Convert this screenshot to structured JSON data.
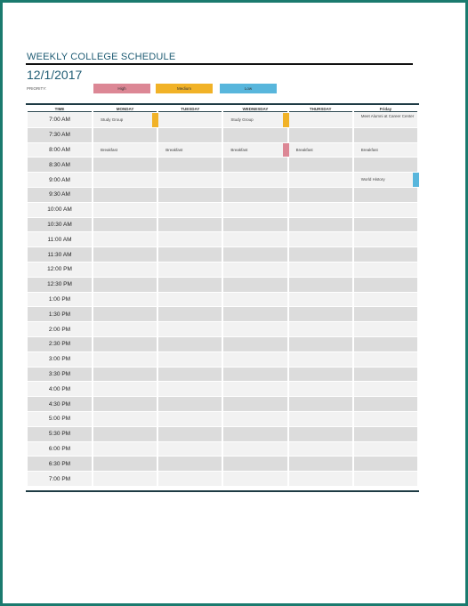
{
  "doc": {
    "title": "WEEKLY COLLEGE SCHEDULE",
    "date": "12/1/2017",
    "priority_label": "PRIORITY:",
    "priorities": {
      "high": "High",
      "medium": "Medium",
      "low": "Low"
    }
  },
  "colors": {
    "high": "#dc8795",
    "medium": "#f1b227",
    "low": "#58b6dc",
    "frame": "#1a7a6e"
  },
  "headers": [
    "TIME",
    "MONDAY",
    "TUESDAY",
    "WEDNESDAY",
    "THURSDAY",
    "Friday"
  ],
  "rows": [
    {
      "time": "7:00 AM",
      "cells": [
        {
          "text": "Study Group",
          "flag": "medium"
        },
        {
          "text": ""
        },
        {
          "text": "Study Group",
          "flag": "medium"
        },
        {
          "text": ""
        },
        {
          "text": "Meet Alumni at Career Center"
        }
      ]
    },
    {
      "time": "7:30 AM",
      "cells": [
        {
          "text": ""
        },
        {
          "text": ""
        },
        {
          "text": ""
        },
        {
          "text": ""
        },
        {
          "text": ""
        }
      ]
    },
    {
      "time": "8:00 AM",
      "cells": [
        {
          "text": "Breakfast"
        },
        {
          "text": "Breakfast"
        },
        {
          "text": "Breakfast",
          "flag": "high"
        },
        {
          "text": "Breakfast"
        },
        {
          "text": "Breakfast"
        }
      ]
    },
    {
      "time": "8:30 AM",
      "cells": [
        {
          "text": ""
        },
        {
          "text": ""
        },
        {
          "text": ""
        },
        {
          "text": ""
        },
        {
          "text": ""
        }
      ]
    },
    {
      "time": "9:00 AM",
      "cells": [
        {
          "text": ""
        },
        {
          "text": ""
        },
        {
          "text": ""
        },
        {
          "text": ""
        },
        {
          "text": "World History",
          "flag": "low"
        }
      ]
    },
    {
      "time": "9:30 AM",
      "cells": [
        {
          "text": ""
        },
        {
          "text": ""
        },
        {
          "text": ""
        },
        {
          "text": ""
        },
        {
          "text": ""
        }
      ]
    },
    {
      "time": "10:00 AM",
      "cells": [
        {
          "text": ""
        },
        {
          "text": ""
        },
        {
          "text": ""
        },
        {
          "text": ""
        },
        {
          "text": ""
        }
      ]
    },
    {
      "time": "10:30 AM",
      "cells": [
        {
          "text": ""
        },
        {
          "text": ""
        },
        {
          "text": ""
        },
        {
          "text": ""
        },
        {
          "text": ""
        }
      ]
    },
    {
      "time": "11:00 AM",
      "cells": [
        {
          "text": ""
        },
        {
          "text": ""
        },
        {
          "text": ""
        },
        {
          "text": ""
        },
        {
          "text": ""
        }
      ]
    },
    {
      "time": "11:30 AM",
      "cells": [
        {
          "text": ""
        },
        {
          "text": ""
        },
        {
          "text": ""
        },
        {
          "text": ""
        },
        {
          "text": ""
        }
      ]
    },
    {
      "time": "12:00 PM",
      "cells": [
        {
          "text": ""
        },
        {
          "text": ""
        },
        {
          "text": ""
        },
        {
          "text": ""
        },
        {
          "text": ""
        }
      ]
    },
    {
      "time": "12:30 PM",
      "cells": [
        {
          "text": ""
        },
        {
          "text": ""
        },
        {
          "text": ""
        },
        {
          "text": ""
        },
        {
          "text": ""
        }
      ]
    },
    {
      "time": "1:00 PM",
      "cells": [
        {
          "text": ""
        },
        {
          "text": ""
        },
        {
          "text": ""
        },
        {
          "text": ""
        },
        {
          "text": ""
        }
      ]
    },
    {
      "time": "1:30 PM",
      "cells": [
        {
          "text": ""
        },
        {
          "text": ""
        },
        {
          "text": ""
        },
        {
          "text": ""
        },
        {
          "text": ""
        }
      ]
    },
    {
      "time": "2:00 PM",
      "cells": [
        {
          "text": ""
        },
        {
          "text": ""
        },
        {
          "text": ""
        },
        {
          "text": ""
        },
        {
          "text": ""
        }
      ]
    },
    {
      "time": "2:30 PM",
      "cells": [
        {
          "text": ""
        },
        {
          "text": ""
        },
        {
          "text": ""
        },
        {
          "text": ""
        },
        {
          "text": ""
        }
      ]
    },
    {
      "time": "3:00 PM",
      "cells": [
        {
          "text": ""
        },
        {
          "text": ""
        },
        {
          "text": ""
        },
        {
          "text": ""
        },
        {
          "text": ""
        }
      ]
    },
    {
      "time": "3:30 PM",
      "cells": [
        {
          "text": ""
        },
        {
          "text": ""
        },
        {
          "text": ""
        },
        {
          "text": ""
        },
        {
          "text": ""
        }
      ]
    },
    {
      "time": "4:00 PM",
      "cells": [
        {
          "text": ""
        },
        {
          "text": ""
        },
        {
          "text": ""
        },
        {
          "text": ""
        },
        {
          "text": ""
        }
      ]
    },
    {
      "time": "4:30 PM",
      "cells": [
        {
          "text": ""
        },
        {
          "text": ""
        },
        {
          "text": ""
        },
        {
          "text": ""
        },
        {
          "text": ""
        }
      ]
    },
    {
      "time": "5:00 PM",
      "cells": [
        {
          "text": ""
        },
        {
          "text": ""
        },
        {
          "text": ""
        },
        {
          "text": ""
        },
        {
          "text": ""
        }
      ]
    },
    {
      "time": "5:30 PM",
      "cells": [
        {
          "text": ""
        },
        {
          "text": ""
        },
        {
          "text": ""
        },
        {
          "text": ""
        },
        {
          "text": ""
        }
      ]
    },
    {
      "time": "6:00 PM",
      "cells": [
        {
          "text": ""
        },
        {
          "text": ""
        },
        {
          "text": ""
        },
        {
          "text": ""
        },
        {
          "text": ""
        }
      ]
    },
    {
      "time": "6:30 PM",
      "cells": [
        {
          "text": ""
        },
        {
          "text": ""
        },
        {
          "text": ""
        },
        {
          "text": ""
        },
        {
          "text": ""
        }
      ]
    },
    {
      "time": "7:00 PM",
      "cells": [
        {
          "text": ""
        },
        {
          "text": ""
        },
        {
          "text": ""
        },
        {
          "text": ""
        },
        {
          "text": ""
        }
      ]
    }
  ]
}
